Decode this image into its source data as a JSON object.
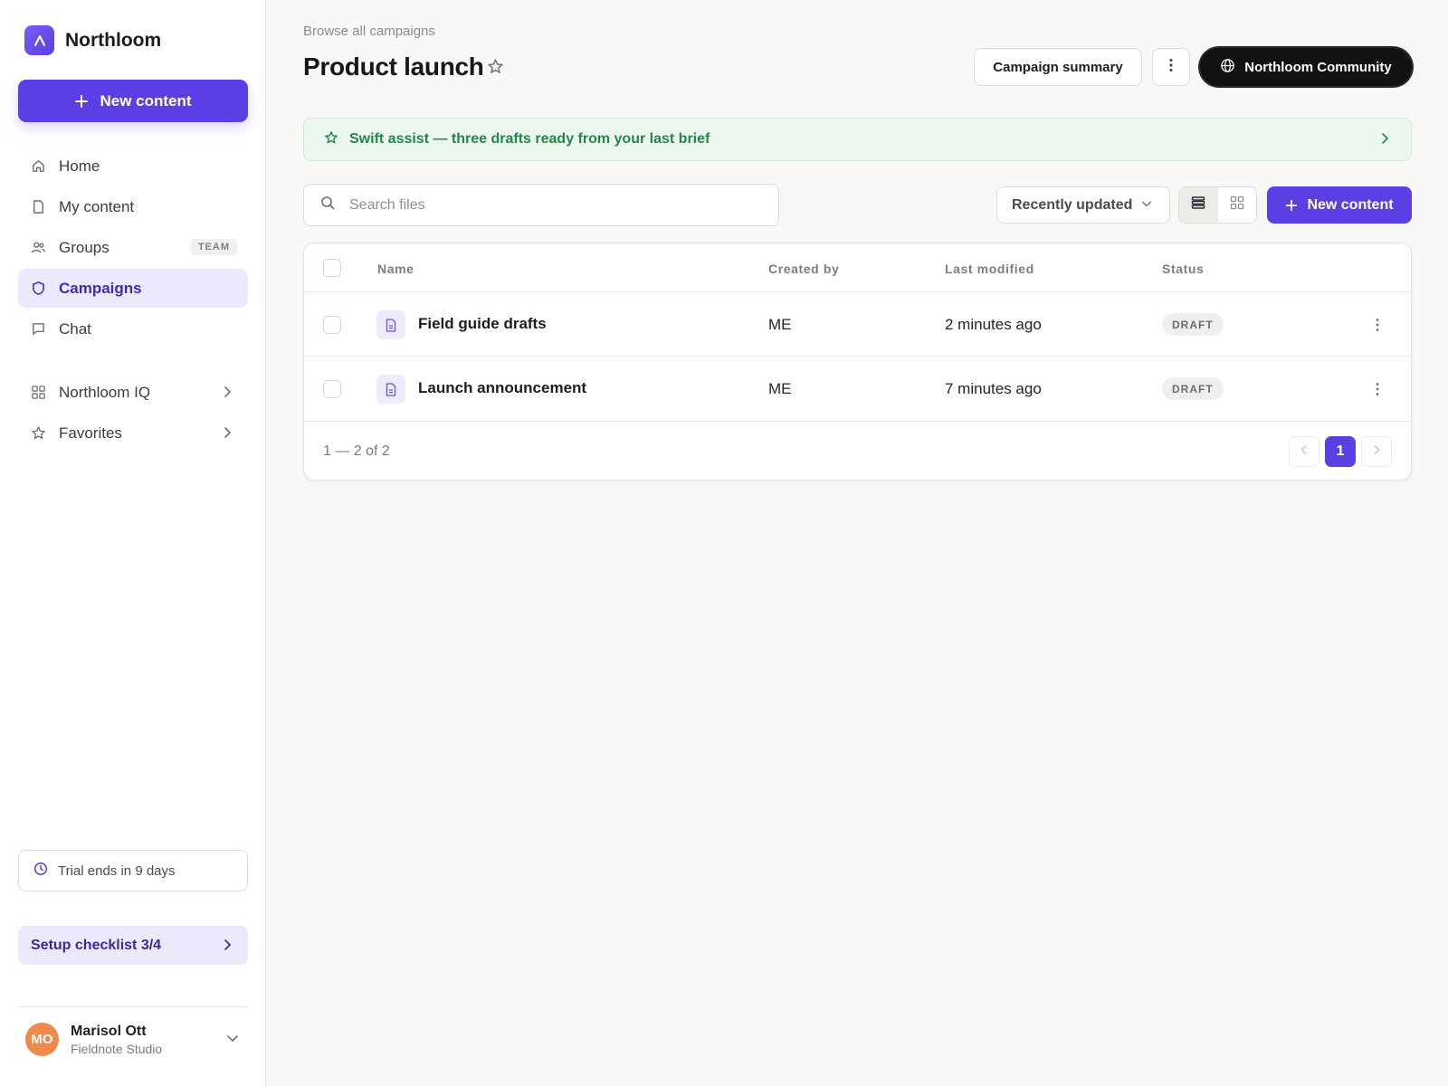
{
  "app": {
    "name": "Northloom"
  },
  "sidebar": {
    "new_button": "New content",
    "items": [
      {
        "label": "Home",
        "icon": "home-icon"
      },
      {
        "label": "My content",
        "icon": "file-icon"
      },
      {
        "label": "Groups",
        "icon": "users-icon",
        "badge": "TEAM"
      },
      {
        "label": "Campaigns",
        "icon": "shield-icon",
        "active": true
      },
      {
        "label": "Chat",
        "icon": "chat-icon"
      }
    ],
    "groups": [
      {
        "label": "Northloom IQ",
        "icon": "grid-icon"
      },
      {
        "label": "Favorites",
        "icon": "star-icon"
      }
    ],
    "trial": "Trial ends in 9 days",
    "checklist": "Setup checklist 3/4",
    "user": {
      "initials": "MO",
      "name": "Marisol Ott",
      "org": "Fieldnote Studio"
    }
  },
  "header": {
    "breadcrumb": "Browse all campaigns",
    "title": "Product launch",
    "summary_button": "Campaign summary",
    "community_button": "Northloom Community"
  },
  "banner": {
    "text": "Swift assist — three drafts ready from your last brief"
  },
  "toolbar": {
    "search_placeholder": "Search files",
    "sort_label": "Recently updated",
    "new_button": "New content"
  },
  "table": {
    "columns": [
      "Name",
      "Created by",
      "Last modified",
      "Status"
    ],
    "rows": [
      {
        "name": "Field guide drafts",
        "created_by": "ME",
        "modified": "2 minutes ago",
        "status": "DRAFT"
      },
      {
        "name": "Launch announcement",
        "created_by": "ME",
        "modified": "7 minutes ago",
        "status": "DRAFT"
      }
    ],
    "range": "1 — 2 of 2",
    "current_page": "1"
  },
  "colors": {
    "accent": "#5b3fe4",
    "banner_text": "#23864a",
    "avatar": "#f08a4b"
  }
}
